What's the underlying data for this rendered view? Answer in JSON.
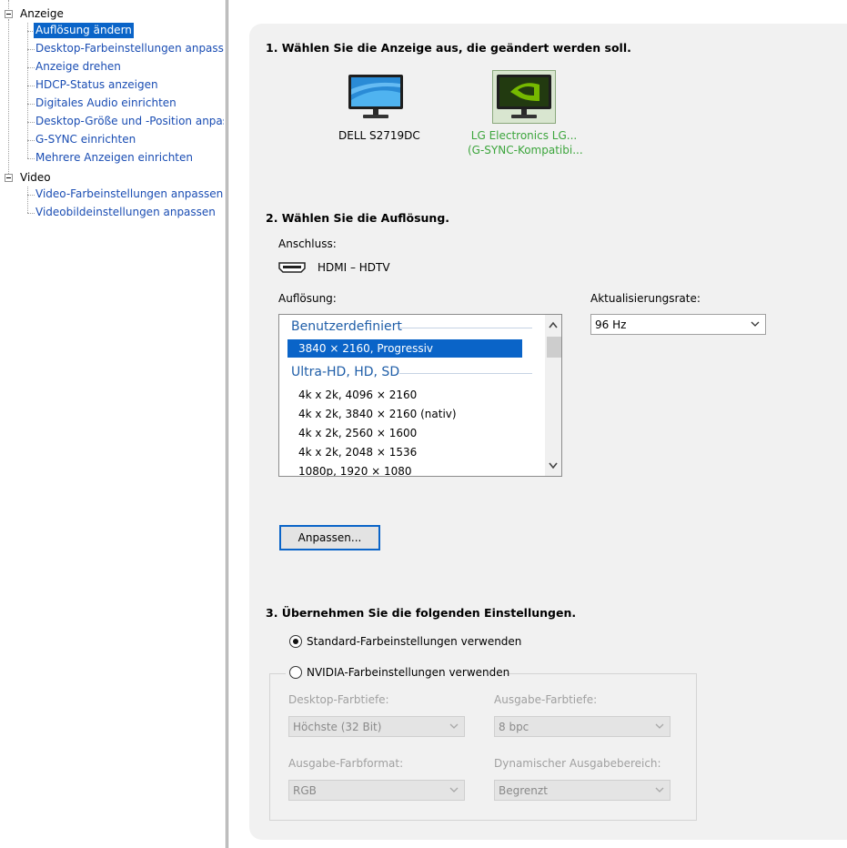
{
  "tree": {
    "groups": [
      {
        "label": "Anzeige",
        "items": [
          {
            "label": "Auflösung ändern",
            "selected": true
          },
          {
            "label": "Desktop-Farbeinstellungen anpassen"
          },
          {
            "label": "Anzeige drehen"
          },
          {
            "label": "HDCP-Status anzeigen"
          },
          {
            "label": "Digitales Audio einrichten"
          },
          {
            "label": "Desktop-Größe und -Position anpassen"
          },
          {
            "label": "G-SYNC einrichten"
          },
          {
            "label": "Mehrere Anzeigen einrichten"
          }
        ]
      },
      {
        "label": "Video",
        "items": [
          {
            "label": "Video-Farbeinstellungen anpassen"
          },
          {
            "label": "Videobildeinstellungen anpassen"
          }
        ]
      }
    ]
  },
  "section1": {
    "title": "1. Wählen Sie die Anzeige aus, die geändert werden soll.",
    "displays": [
      {
        "name_line1": "DELL S2719DC",
        "name_line2": "",
        "selected": false
      },
      {
        "name_line1": "LG Electronics LG...",
        "name_line2": "(G-SYNC-Kompatibi...",
        "selected": true
      }
    ],
    "selected_color": "#3ca53c"
  },
  "section2": {
    "title": "2. Wählen Sie die Auflösung.",
    "connection_label": "Anschluss:",
    "connection_value": "HDMI – HDTV",
    "resolution_label": "Auflösung:",
    "refresh_label": "Aktualisierungsrate:",
    "refresh_value": "96 Hz",
    "list": {
      "group1": "Benutzerdefiniert",
      "group1_items": [
        "3840 × 2160, Progressiv"
      ],
      "group2": "Ultra-HD, HD, SD",
      "group2_items": [
        "4k x 2k, 4096 × 2160",
        "4k x 2k, 3840 × 2160 (nativ)",
        "4k x 2k, 2560 × 1600",
        "4k x 2k, 2048 × 1536",
        "1080p, 1920 × 1080"
      ]
    },
    "customize_button": "Anpassen..."
  },
  "section3": {
    "title": "3. Übernehmen Sie die folgenden Einstellungen.",
    "radio_default": "Standard-Farbeinstellungen verwenden",
    "radio_nvidia": "NVIDIA-Farbeinstellungen verwenden",
    "desktop_depth_label": "Desktop-Farbtiefe:",
    "desktop_depth_value": "Höchste (32 Bit)",
    "output_depth_label": "Ausgabe-Farbtiefe:",
    "output_depth_value": "8 bpc",
    "output_format_label": "Ausgabe-Farbformat:",
    "output_format_value": "RGB",
    "dynamic_range_label": "Dynamischer Ausgabebereich:",
    "dynamic_range_value": "Begrenzt"
  },
  "colors": {
    "accent": "#0a64c8",
    "link": "#1a4db3",
    "nvidia_green": "#76b900"
  }
}
